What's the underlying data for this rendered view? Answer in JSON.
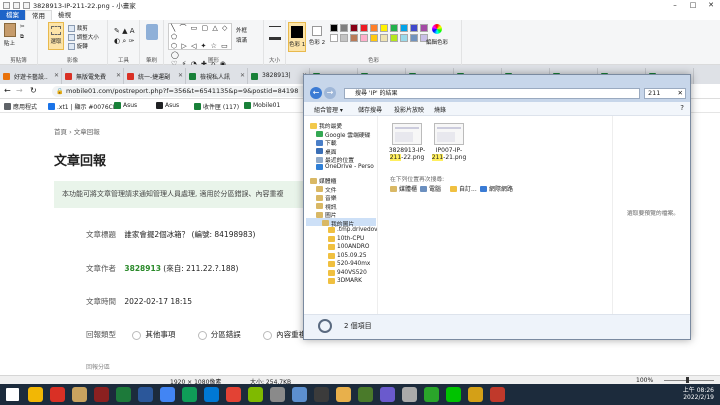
{
  "paint": {
    "title": "3828913-IP-211-22.png - 小畫家",
    "file_tab": "檔案",
    "tabs": [
      "常用",
      "檢視"
    ],
    "groups": {
      "clipboard": {
        "label": "剪貼簿",
        "paste": "貼上",
        "cut": "剪下",
        "copy": "複製"
      },
      "image": {
        "label": "影像",
        "select": "選取",
        "crop": "裁剪",
        "resize": "調整大小",
        "rotate": "旋轉"
      },
      "tools": {
        "label": "工具"
      },
      "brushes": {
        "label": "筆刷"
      },
      "shapes": {
        "label": "圖形",
        "outline": "外框",
        "fill": "填滿"
      },
      "size": {
        "label": "大小"
      },
      "colors": {
        "label": "色彩",
        "color1": "色彩 1",
        "color2": "色彩 2",
        "edit": "編輯色彩"
      }
    },
    "palette": [
      "#000000",
      "#7f7f7f",
      "#880015",
      "#ed1c24",
      "#ff7f27",
      "#fff200",
      "#22b14c",
      "#00a2e8",
      "#3f48cc",
      "#a349a4",
      "#ffffff",
      "#c3c3c3",
      "#b97a57",
      "#ffaec9",
      "#ffc90e",
      "#efe4b0",
      "#b5e61d",
      "#99d9ea",
      "#7092be",
      "#c8bfe7"
    ],
    "status": {
      "dimensions": "1920 × 1080像素",
      "size": "大小: 254.7KB",
      "zoom": "100%"
    }
  },
  "browser": {
    "tabs": [
      {
        "label": "好遊卡藝設..",
        "color": "#e8710a"
      },
      {
        "label": "無版電免費",
        "color": "#d93025"
      },
      {
        "label": "統一-捷運副",
        "color": "#d93025"
      },
      {
        "label": "檢視私人訊",
        "color": "#188038"
      },
      {
        "label": "3828913|",
        "color": "#188038"
      }
    ],
    "url": "mobile01.com/postreport.php?f=356&t=6541135&p=9&postid=84198",
    "bookmarks": [
      "應用程式",
      ".xt1 | 顯示 #0076CE:",
      "Asus",
      "Asus",
      "收件匣 (117)",
      "Mobile01"
    ],
    "page": {
      "breadcrumb": [
        "首頁",
        "文章回報"
      ],
      "title": "文章回報",
      "notice": "本功能可將文章管理請求通知管理人員處理, 適用於分區錯誤、內容重複",
      "fields": [
        {
          "label": "文章標題",
          "value": "誰家會擺2個冰箱？ (編號: 84198983)"
        },
        {
          "label": "文章作者",
          "value": "3828913",
          "suffix": " (來自: 211.22.?.188)"
        },
        {
          "label": "文章時間",
          "value": "2022-02-17 18:15"
        }
      ],
      "report_type_label": "回報類型",
      "report_options": [
        "其他事項",
        "分區錯誤",
        "內容重複"
      ],
      "partial_label": "回報分區"
    }
  },
  "explorer": {
    "title": "搜尋 'IP' 的結果",
    "search_value": "211",
    "toolbar": [
      "組合管理 ▾",
      "儲存搜尋",
      "投影片放映",
      "燒錄"
    ],
    "nav": {
      "favorites": "我的最愛",
      "fav_items": [
        "Google 雲端硬碟",
        "下載",
        "桌面",
        "最近的位置",
        "OneDrive - Perso"
      ],
      "libraries": "媒體櫃",
      "lib_items": [
        "文件",
        "音樂",
        "視訊",
        "圖片"
      ],
      "my_pictures": "我的圖片",
      "folders": [
        ".tmp.drivedov",
        "10th-CPU",
        "100ANDRO",
        "105.09.25",
        "520-940mx",
        "940VS520",
        "3DMARK"
      ]
    },
    "files": [
      {
        "pre": "3828913-IP-",
        "hl": "211",
        "post": "-22.png"
      },
      {
        "pre": "IP007-IP-",
        "hl": "211",
        "post": "-21.png"
      }
    ],
    "search_again_label": "在下列位置再次搜尋:",
    "search_locations": [
      "媒體櫃",
      "電腦",
      "自訂...",
      "網際網路"
    ],
    "preview_text": "選取要預覽的檔案。",
    "item_count": "2 個項目"
  },
  "taskbar": {
    "time": "上午 08:26",
    "date": "2022/2/19"
  }
}
